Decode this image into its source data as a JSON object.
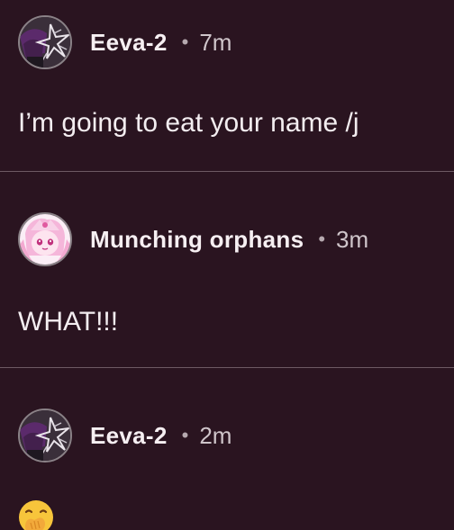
{
  "comments": [
    {
      "username": "Eeva-2",
      "separator": "•",
      "time": "7m",
      "text": "I’m going to eat your name /j",
      "avatar": "dark-purple-avatar"
    },
    {
      "username": "Munching orphans",
      "separator": "•",
      "time": "3m",
      "text": "WHAT!!!",
      "avatar": "pink-anime-avatar"
    },
    {
      "username": "Eeva-2",
      "separator": "•",
      "time": "2m",
      "emoji": "face-with-hand-over-mouth",
      "avatar": "dark-purple-avatar"
    }
  ],
  "colors": {
    "background": "#2a1420",
    "divider": "#6e5a63",
    "text": "#f3edf0",
    "secondary": "#cfc5ca"
  }
}
